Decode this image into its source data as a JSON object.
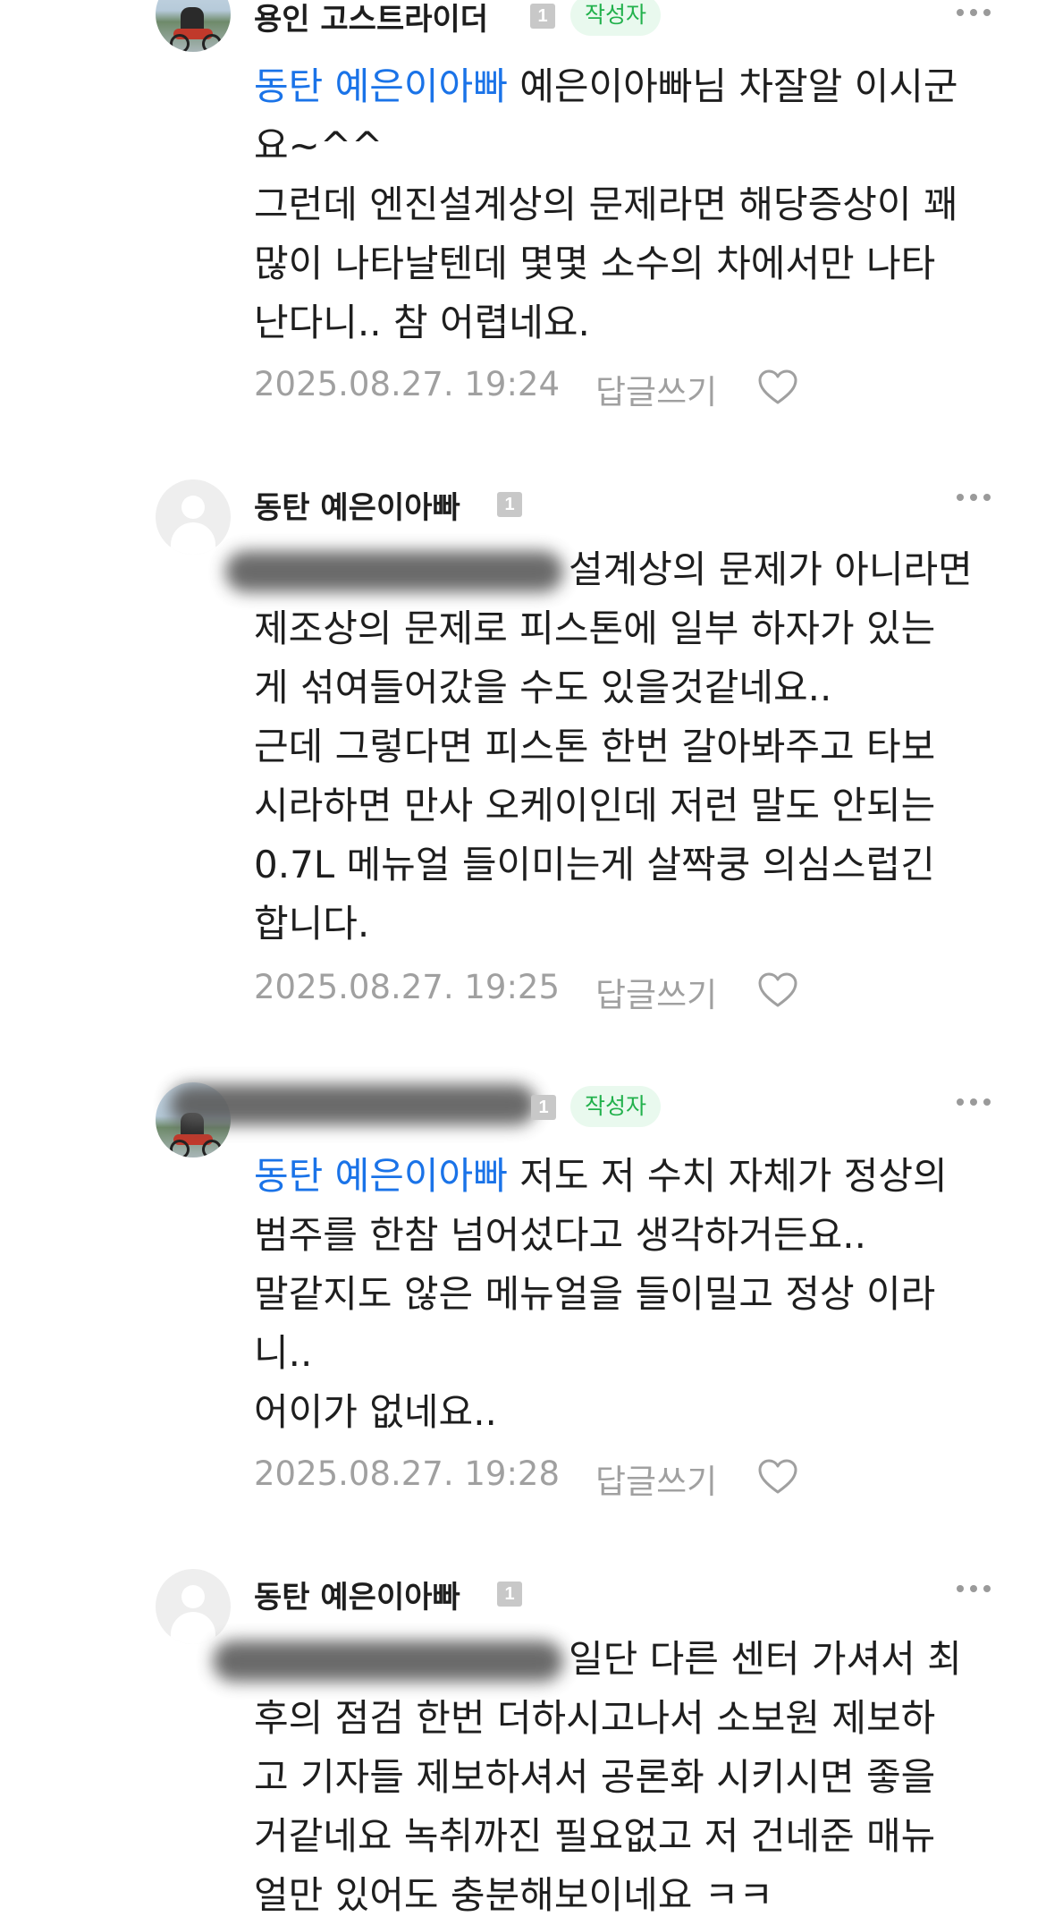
{
  "comments": [
    {
      "nickname": "용인 고스트라이더",
      "level": "1",
      "badge": "작성자",
      "avatar": "photo-avatar",
      "mention": "동탄 예은이아빠",
      "lines": [
        " 예은이아빠님 차잘알 이시군",
        "요~^^",
        "그런데 엔진설계상의 문제라면 해당증상이 꽤",
        "많이 나타날텐데 몇몇 소수의 차에서만 나타",
        "난다니.. 참 어렵네요."
      ],
      "date": "2025.08.27. 19:24",
      "reply_label": "답글쓰기"
    },
    {
      "nickname": "동탄 예은이아빠",
      "level": "1",
      "avatar": "default-avatar",
      "lines": [
        "설계상의 문제가 아니라면",
        "제조상의 문제로 피스톤에 일부 하자가 있는",
        "게 섞여들어갔을 수도 있을것같네요..",
        "근데 그렇다면 피스톤 한번 갈아봐주고 타보",
        "시라하면 만사 오케이인데 저런 말도 안되는",
        "0.7L 메뉴얼 들이미는게 살짝쿵 의심스럽긴",
        "합니다."
      ],
      "date": "2025.08.27. 19:25",
      "reply_label": "답글쓰기"
    },
    {
      "level": "1",
      "badge": "작성자",
      "avatar": "photo-avatar",
      "mention": "동탄 예은이아빠",
      "lines": [
        " 저도 저 수치 자체가 정상의",
        "범주를 한참 넘어섰다고 생각하거든요..",
        "말같지도 않은 메뉴얼을 들이밀고 정상 이라",
        "니..",
        "어이가 없네요.."
      ],
      "date": "2025.08.27. 19:28",
      "reply_label": "답글쓰기"
    },
    {
      "nickname": "동탄 예은이아빠",
      "level": "1",
      "avatar": "default-avatar",
      "lines": [
        "일단 다른 센터 가셔서 최",
        "후의 점검 한번 더하시고나서 소보원 제보하",
        "고 기자들 제보하셔서 공론화 시키시면 좋을",
        "거같네요 녹취까진 필요없고 저 건네준 매뉴",
        "얼만 있어도 충분해보이네요 ㅋㅋ"
      ]
    }
  ],
  "icons": {
    "more": "more-dots-icon",
    "like": "heart-outline-icon",
    "level": "member-level-icon"
  },
  "colors": {
    "mention": "#1a73e8",
    "author_badge_text": "#22b14c",
    "author_badge_bg": "#e9f9ee",
    "meta_text": "#a0a0a0"
  }
}
